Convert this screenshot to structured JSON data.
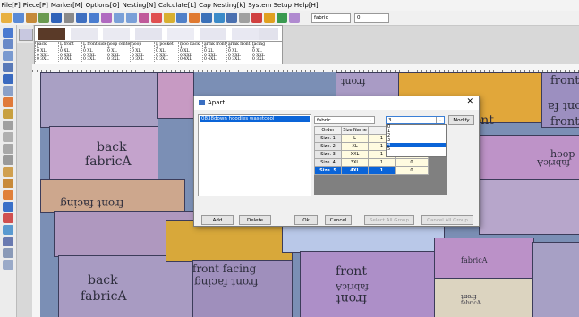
{
  "menu": [
    "File[F]",
    "Piece[P]",
    "Marker[M]",
    "Options[O]",
    "Nesting[N]",
    "Calculate[L]",
    "Cap Nesting[k]",
    "System Setup",
    "Help[H]"
  ],
  "toolbar": {
    "fabric_select": "fabric",
    "second_select": "0"
  },
  "piece_table": {
    "columns": [
      {
        "name": "back",
        "cells": [
          "L",
          "0 XL",
          "0 XXL",
          "0 3XL"
        ]
      },
      {
        "name": "L front",
        "cells": [
          "1",
          "0 XL",
          "0 XXL",
          "0 3XL"
        ]
      },
      {
        "name": "L front side",
        "cells": [
          "1",
          "0 XL",
          "0 XXL",
          "0 3XL"
        ]
      },
      {
        "name": "hoop center",
        "cells": [
          "2",
          "0 XL",
          "0 XXL",
          "0 3XL"
        ]
      },
      {
        "name": "hoop",
        "cells": [
          "L",
          "0 XL",
          "0 XXL",
          "0 3XL"
        ]
      },
      {
        "name": "L pocket",
        "cells": [
          "2",
          "0 XL",
          "0 XXL",
          "0 3XL"
        ]
      },
      {
        "name": "moo back",
        "cells": [
          "1",
          "0 XL",
          "0 XXL",
          "0 4XL"
        ]
      },
      {
        "name": "armk front",
        "cells": [
          "2",
          "0 XL",
          "0 XXL",
          "0 4XL"
        ]
      },
      {
        "name": "armk front",
        "cells": [
          "2",
          "0 XL",
          "0 XXL",
          "0 3XL"
        ]
      },
      {
        "name": "facing",
        "cells": [
          "2",
          "0 XL",
          "0 XXL",
          "0 3XL"
        ]
      }
    ]
  },
  "canvas_labels": {
    "back1": "back",
    "fabric1": "fabricA",
    "front_facing1": "front facing",
    "front_facing_flip": "front facing",
    "back2": "back",
    "fabric2": "fabricA",
    "front_facing2": "front facing",
    "front_flip1": "front",
    "front1": "front",
    "fabric_flip1": "fabricA",
    "front_flip2": "front",
    "front2": "front",
    "fabric3": "fabricA",
    "front_flip3": "front",
    "fabric4": "fabricA",
    "front_fa1": "front fa",
    "front_fa_flip": "front fa",
    "front_fa2": "front fa",
    "fabric_flip2": "fabricA",
    "hoop": "hoop"
  },
  "dialog": {
    "title": "Apart",
    "list_selected": "0838down hoodies wasetcool",
    "fabric_value": "fabric",
    "size_value": "3",
    "modify_label": "Modify",
    "dropdown_options": [
      "0",
      "1",
      "2",
      "3",
      "4",
      "5"
    ],
    "dropdown_highlight": 4,
    "grid_headers": [
      "Order",
      "Size Name",
      "",
      ""
    ],
    "rows": [
      {
        "order": "Size. 1",
        "size": "L",
        "a": "1",
        "b": "0"
      },
      {
        "order": "Size. 2",
        "size": "XL",
        "a": "1",
        "b": "0"
      },
      {
        "order": "Size. 3",
        "size": "XXL",
        "a": "1",
        "b": "0"
      },
      {
        "order": "Size. 4",
        "size": "3XL",
        "a": "1",
        "b": "0"
      },
      {
        "order": "Size. 5",
        "size": "4XL",
        "a": "1",
        "b": "0"
      }
    ],
    "buttons": {
      "add": "Add",
      "delete": "Delete",
      "ok": "Ok",
      "cancel": "Cancel",
      "select_all": "Select All Group",
      "cancel_all": "Cancel All Group"
    }
  }
}
